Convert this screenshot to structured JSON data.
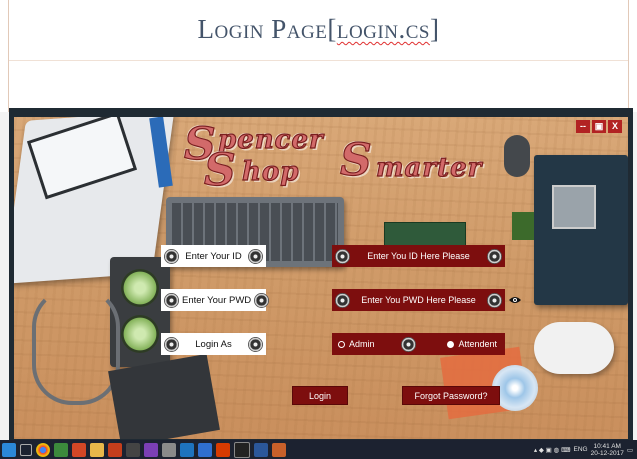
{
  "document": {
    "title_prefix": "Login Page[",
    "title_file": "login.cs",
    "title_suffix": "]"
  },
  "logo": {
    "line1_big1": "S",
    "line1_small": "pencer",
    "line1_big2": "S",
    "line2_a": "hop",
    "line2_b": "marter"
  },
  "window_controls": {
    "minimize": "--",
    "maximize": "▣",
    "close": "X"
  },
  "form": {
    "id_label": "Enter Your ID",
    "pwd_label": "Enter Your PWD",
    "role_label": "Login As",
    "id_input_placeholder": "Enter You ID Here Please",
    "pwd_input_placeholder": "Enter You PWD Here Please",
    "role_options": [
      "Admin",
      "Attendent"
    ],
    "role_selected": "Attendent"
  },
  "buttons": {
    "login": "Login",
    "forgot": "Forgot Password?"
  },
  "taskbar": {
    "language": "ENG",
    "time": "10:41 AM",
    "date": "20-12-2017"
  },
  "colors": {
    "accent_dark_red": "#7d0e0e",
    "logo_red": "#d26a6a",
    "doc_title": "#44546a",
    "taskbar": "#1c2230"
  }
}
